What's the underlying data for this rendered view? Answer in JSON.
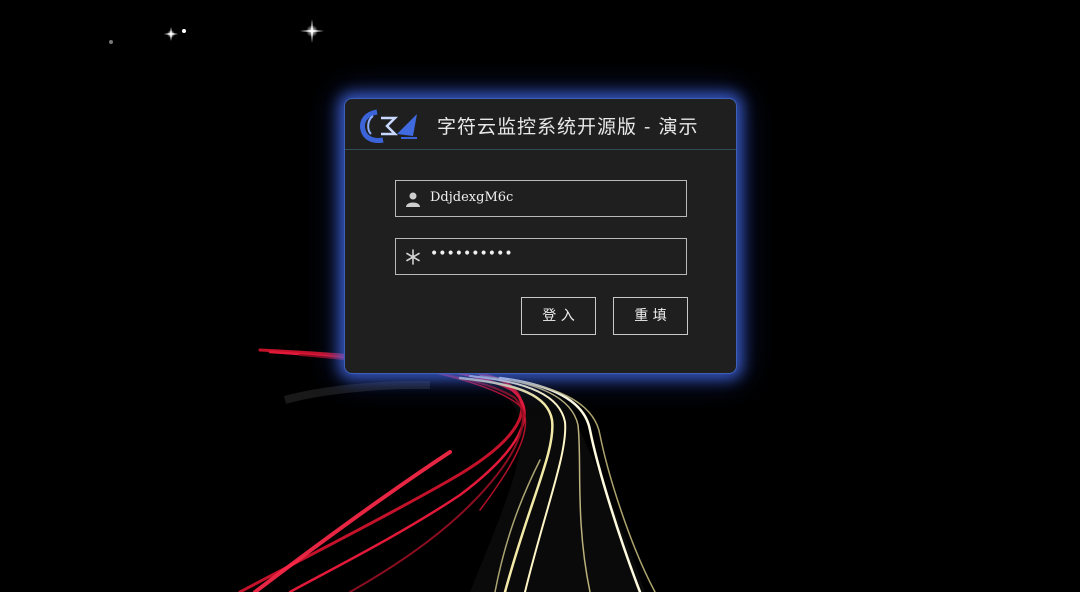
{
  "login": {
    "title": "字符云监控系统开源版 - 演示",
    "username_value": "DdjdexgM6c",
    "password_mask": "••••••••••",
    "login_label": "登 入",
    "reset_label": "重 填"
  },
  "icons": {
    "logo": "cloud-sigma-logo",
    "username": "user-icon",
    "password": "snowflake-icon"
  },
  "colors": {
    "background": "#000000",
    "panel": "#1f1f1f",
    "glow": "#4670f0",
    "text": "#f0f0f0"
  }
}
